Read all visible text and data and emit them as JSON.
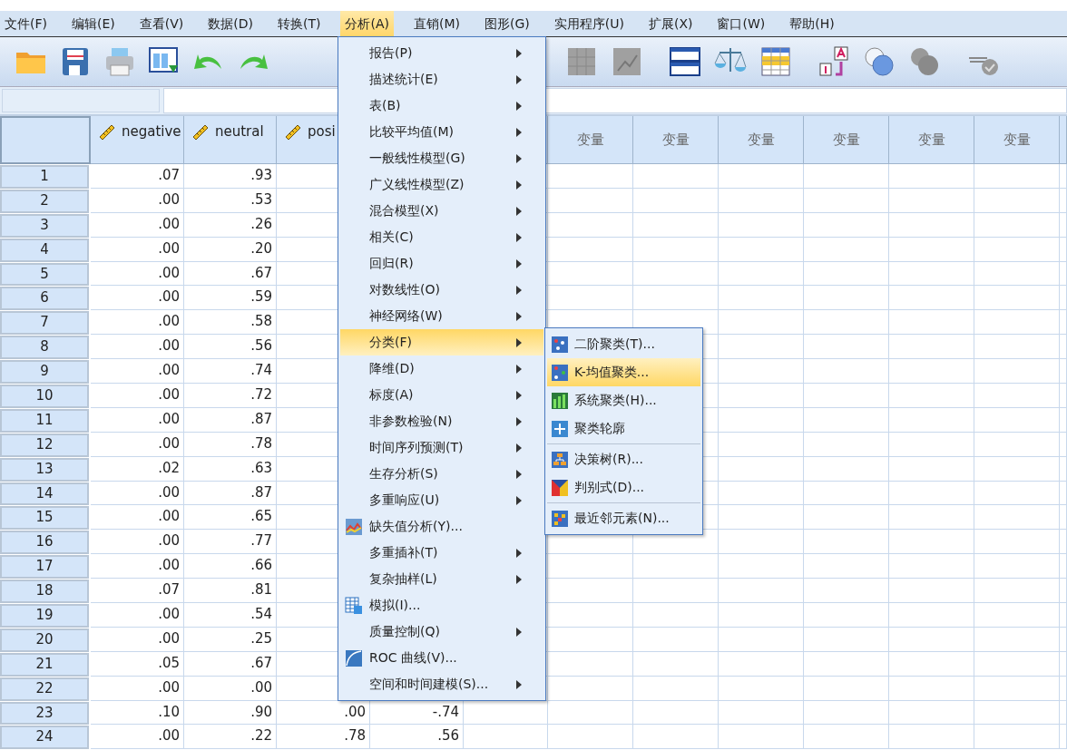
{
  "menu_bar": [
    {
      "label": "文件(F)",
      "selected": false
    },
    {
      "label": "编辑(E)",
      "selected": false
    },
    {
      "label": "查看(V)",
      "selected": false
    },
    {
      "label": "数据(D)",
      "selected": false
    },
    {
      "label": "转换(T)",
      "selected": false
    },
    {
      "label": "分析(A)",
      "selected": true
    },
    {
      "label": "直销(M)",
      "selected": false
    },
    {
      "label": "图形(G)",
      "selected": false
    },
    {
      "label": "实用程序(U)",
      "selected": false
    },
    {
      "label": "扩展(X)",
      "selected": false
    },
    {
      "label": "窗口(W)",
      "selected": false
    },
    {
      "label": "帮助(H)",
      "selected": false
    }
  ],
  "grid": {
    "columns": [
      {
        "name": "negative"
      },
      {
        "name": "neutral"
      },
      {
        "name": "posi"
      }
    ],
    "empty_columns": [
      "变量",
      "变量",
      "变量",
      "变量",
      "变量",
      "变量"
    ],
    "rows": [
      {
        "label": "1",
        "cells": [
          ".07",
          ".93"
        ]
      },
      {
        "label": "2",
        "cells": [
          ".00",
          ".53"
        ]
      },
      {
        "label": "3",
        "cells": [
          ".00",
          ".26"
        ]
      },
      {
        "label": "4",
        "cells": [
          ".00",
          ".20"
        ]
      },
      {
        "label": "5",
        "cells": [
          ".00",
          ".67"
        ]
      },
      {
        "label": "6",
        "cells": [
          ".00",
          ".59"
        ]
      },
      {
        "label": "7",
        "cells": [
          ".00",
          ".58"
        ]
      },
      {
        "label": "8",
        "cells": [
          ".00",
          ".56"
        ]
      },
      {
        "label": "9",
        "cells": [
          ".00",
          ".74"
        ]
      },
      {
        "label": "10",
        "cells": [
          ".00",
          ".72"
        ]
      },
      {
        "label": "11",
        "cells": [
          ".00",
          ".87"
        ]
      },
      {
        "label": "12",
        "cells": [
          ".00",
          ".78"
        ]
      },
      {
        "label": "13",
        "cells": [
          ".02",
          ".63"
        ]
      },
      {
        "label": "14",
        "cells": [
          ".00",
          ".87"
        ]
      },
      {
        "label": "15",
        "cells": [
          ".00",
          ".65"
        ]
      },
      {
        "label": "16",
        "cells": [
          ".00",
          ".77"
        ]
      },
      {
        "label": "17",
        "cells": [
          ".00",
          ".66"
        ]
      },
      {
        "label": "18",
        "cells": [
          ".07",
          ".81"
        ]
      },
      {
        "label": "19",
        "cells": [
          ".00",
          ".54"
        ]
      },
      {
        "label": "20",
        "cells": [
          ".00",
          ".25"
        ]
      },
      {
        "label": "21",
        "cells": [
          ".05",
          ".67"
        ]
      },
      {
        "label": "22",
        "cells": [
          ".00",
          ".00"
        ]
      },
      {
        "label": "23",
        "cells": [
          ".10",
          ".90",
          ".00",
          "-.74"
        ]
      },
      {
        "label": "24",
        "cells": [
          ".00",
          ".22",
          ".78",
          ".56"
        ]
      }
    ]
  },
  "analyze_menu": [
    {
      "label": "报告(P)",
      "submenu": true,
      "selected": false
    },
    {
      "label": "描述统计(E)",
      "submenu": true,
      "selected": false
    },
    {
      "label": "表(B)",
      "submenu": true,
      "selected": false
    },
    {
      "label": "比较平均值(M)",
      "submenu": true,
      "selected": false
    },
    {
      "label": "一般线性模型(G)",
      "submenu": true,
      "selected": false
    },
    {
      "label": "广义线性模型(Z)",
      "submenu": true,
      "selected": false
    },
    {
      "label": "混合模型(X)",
      "submenu": true,
      "selected": false
    },
    {
      "label": "相关(C)",
      "submenu": true,
      "selected": false
    },
    {
      "label": "回归(R)",
      "submenu": true,
      "selected": false
    },
    {
      "label": "对数线性(O)",
      "submenu": true,
      "selected": false
    },
    {
      "label": "神经网络(W)",
      "submenu": true,
      "selected": false
    },
    {
      "label": "分类(F)",
      "submenu": true,
      "selected": true
    },
    {
      "label": "降维(D)",
      "submenu": true,
      "selected": false
    },
    {
      "label": "标度(A)",
      "submenu": true,
      "selected": false
    },
    {
      "label": "非参数检验(N)",
      "submenu": true,
      "selected": false
    },
    {
      "label": "时间序列预测(T)",
      "submenu": true,
      "selected": false
    },
    {
      "label": "生存分析(S)",
      "submenu": true,
      "selected": false
    },
    {
      "label": "多重响应(U)",
      "submenu": true,
      "selected": false
    },
    {
      "label": "缺失值分析(Y)...",
      "submenu": false,
      "selected": false
    },
    {
      "label": "多重插补(T)",
      "submenu": true,
      "selected": false
    },
    {
      "label": "复杂抽样(L)",
      "submenu": true,
      "selected": false
    },
    {
      "label": "模拟(I)...",
      "submenu": false,
      "selected": false
    },
    {
      "label": "质量控制(Q)",
      "submenu": true,
      "selected": false
    },
    {
      "label": "ROC 曲线(V)...",
      "submenu": false,
      "selected": false
    },
    {
      "label": "空间和时间建模(S)...",
      "submenu": true,
      "selected": false
    }
  ],
  "classify_submenu": [
    [
      {
        "label": "二阶聚类(T)...",
        "selected": false
      },
      {
        "label": "K-均值聚类...",
        "selected": true
      },
      {
        "label": "系统聚类(H)...",
        "selected": false
      },
      {
        "label": "聚类轮廓",
        "selected": false
      }
    ],
    [
      {
        "label": "决策树(R)...",
        "selected": false
      },
      {
        "label": "判别式(D)...",
        "selected": false
      }
    ],
    [
      {
        "label": "最近邻元素(N)...",
        "selected": false
      }
    ]
  ]
}
